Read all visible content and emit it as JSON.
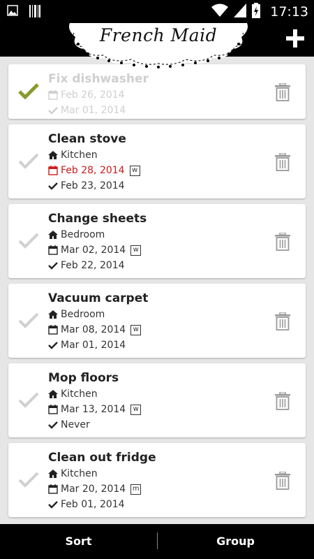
{
  "status_bar": {
    "time": "17:13",
    "left_icons": [
      "image-icon",
      "barcode-icon"
    ],
    "right_icons": [
      "wifi-icon",
      "signal-icon",
      "battery-charging-icon"
    ]
  },
  "header": {
    "title": "French Maid",
    "add_icon": "plus-icon"
  },
  "chores": [
    {
      "title": "Fix dishwasher",
      "room": "",
      "due": "Feb 26, 2014",
      "frequency": "",
      "last_done": "Mar 01, 2014",
      "completed": true,
      "overdue": false
    },
    {
      "title": "Clean stove",
      "room": "Kitchen",
      "due": "Feb 28, 2014",
      "frequency": "w",
      "last_done": "Feb 23, 2014",
      "completed": false,
      "overdue": true
    },
    {
      "title": "Change sheets",
      "room": "Bedroom",
      "due": "Mar 02, 2014",
      "frequency": "w",
      "last_done": "Feb 22, 2014",
      "completed": false,
      "overdue": false
    },
    {
      "title": "Vacuum carpet",
      "room": "Bedroom",
      "due": "Mar 08, 2014",
      "frequency": "w",
      "last_done": "Mar 01, 2014",
      "completed": false,
      "overdue": false
    },
    {
      "title": "Mop floors",
      "room": "Kitchen",
      "due": "Mar 13, 2014",
      "frequency": "w",
      "last_done": "Never",
      "completed": false,
      "overdue": false
    },
    {
      "title": "Clean out fridge",
      "room": "Kitchen",
      "due": "Mar 20, 2014",
      "frequency": "m",
      "last_done": "Feb 01, 2014",
      "completed": false,
      "overdue": false
    }
  ],
  "colors": {
    "done_check": "#8a9a2e",
    "pending_check": "#d0d0d0",
    "overdue": "#cc1a1a",
    "trash": "#9a9a9a"
  },
  "bottom_bar": {
    "sort_label": "Sort",
    "group_label": "Group"
  }
}
